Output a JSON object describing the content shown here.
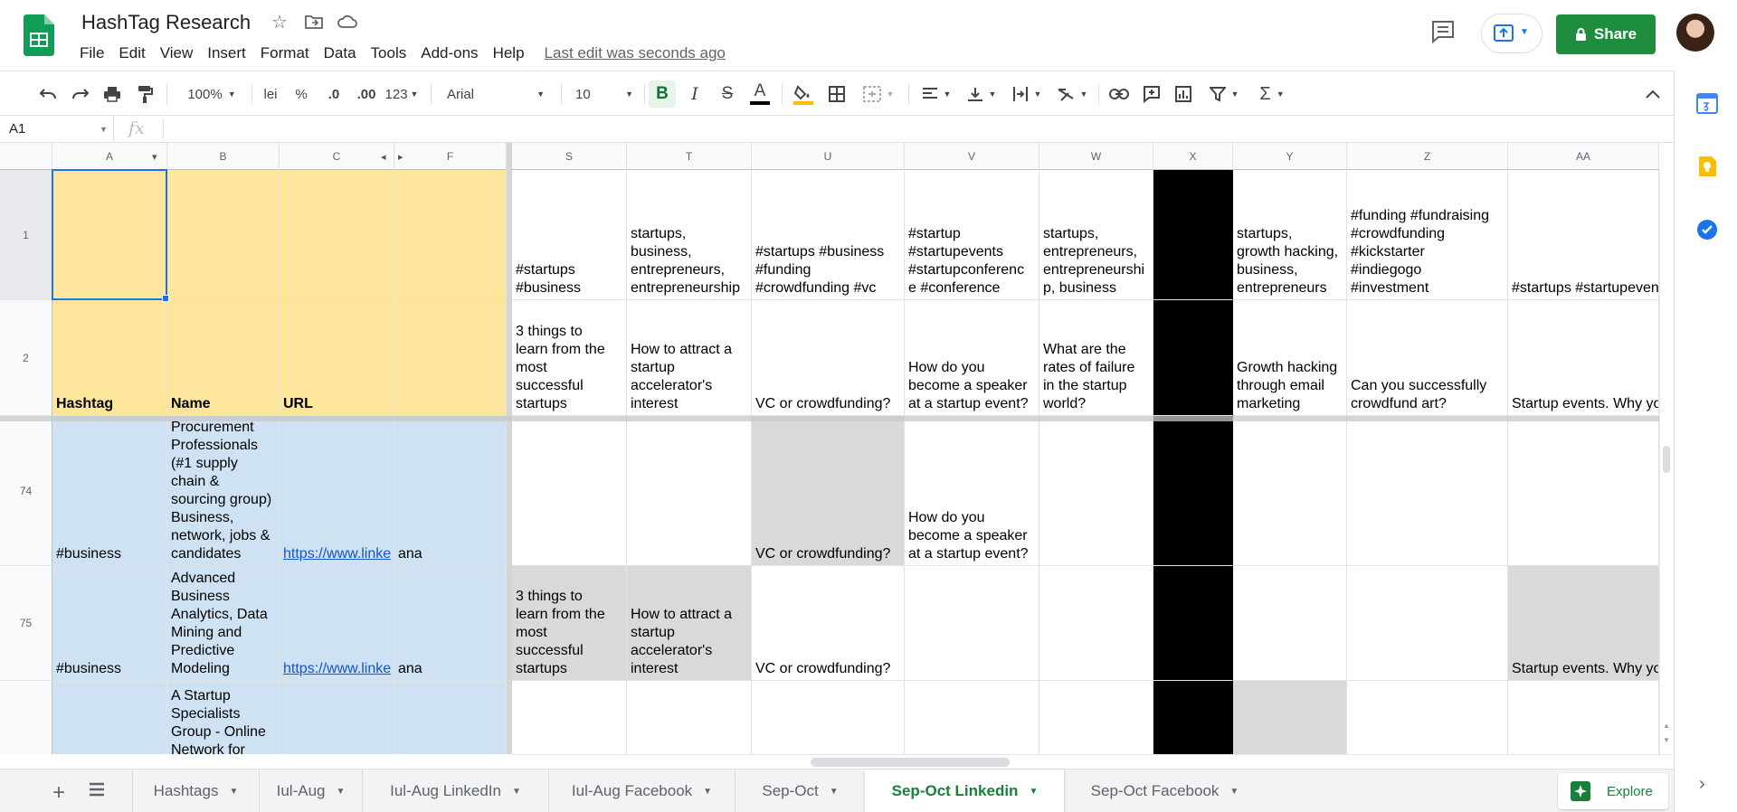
{
  "app": {
    "title": "HashTag Research",
    "menus": [
      "File",
      "Edit",
      "View",
      "Insert",
      "Format",
      "Data",
      "Tools",
      "Add-ons",
      "Help"
    ],
    "last_edit": "Last edit was seconds ago",
    "share_label": "Share"
  },
  "toolbar": {
    "zoom": "100%",
    "currency": "lei",
    "percent": "%",
    "dec_decrease": ".0",
    "dec_increase": ".00",
    "more_formats": "123",
    "font": "Arial",
    "font_size": "10",
    "bold": "B"
  },
  "formula": {
    "cell_ref": "A1",
    "fx": "fx",
    "value": ""
  },
  "grid": {
    "columns": [
      "A",
      "B",
      "C",
      "F",
      "S",
      "T",
      "U",
      "V",
      "W",
      "X",
      "Y",
      "Z",
      "AA"
    ],
    "row_numbers": [
      "1",
      "2",
      "74",
      "75",
      ""
    ],
    "rows": [
      {
        "cells": [
          "",
          "",
          "",
          "",
          "#startups\n#business",
          "startups,\nbusiness,\nentrepreneurs,\nentrepreneurship",
          "#startups #business\n#funding\n#crowdfunding #vc",
          "#startup\n#startupevents\n#startupconferenc\ne #conference",
          "startups,\nentrepreneurs,\nentrepreneurshi\np, business",
          "",
          "startups,\ngrowth hacking,\nbusiness,\nentrepreneurs",
          "#funding #fundraising\n#crowdfunding\n#kickstarter\n#indiegogo\n#investment",
          "#startups #startupeven\n#business #entreprene\n#entrepreneurship"
        ]
      },
      {
        "cells": [
          "Hashtag",
          "Name",
          "URL",
          "",
          "3 things to\nlearn from the\nmost\nsuccessful\nstartups",
          "How to attract a\nstartup\naccelerator's\ninterest",
          "VC or crowdfunding?",
          "How do you\nbecome a speaker\nat a startup event?",
          "What are the\nrates of failure\nin the startup\nworld?",
          "",
          "Growth hacking\nthrough email\nmarketing",
          "Can you successfully\ncrowdfund art?",
          "Startup events. Why yo\nshouldn't skip legal\nissues."
        ]
      },
      {
        "cells": [
          "#business",
          "Procurement\nProfessionals\n(#1 supply\nchain &\nsourcing group)\nBusiness,\nnetwork, jobs &\ncandidates",
          "https://www.linke",
          "ana",
          "",
          "",
          "VC or crowdfunding?",
          "How do you\nbecome a speaker\nat a startup event?",
          "",
          "",
          "",
          "",
          ""
        ]
      },
      {
        "cells": [
          "#business",
          "Advanced\nBusiness\nAnalytics, Data\nMining and\nPredictive\nModeling",
          "https://www.linke",
          "ana",
          "3 things to\nlearn from the\nmost\nsuccessful\nstartups",
          "How to attract a\nstartup\naccelerator's\ninterest",
          "VC or crowdfunding?",
          "",
          "",
          "",
          "",
          "",
          "Startup events. Why yo\nshouldn't skip legal\nissues."
        ]
      },
      {
        "cells": [
          "",
          "A Startup\nSpecialists\nGroup - Online\nNetwork for",
          "",
          "",
          "",
          "",
          "",
          "",
          "",
          "",
          "",
          "",
          ""
        ]
      }
    ]
  },
  "sheets": {
    "tabs": [
      "Hashtags",
      "Iul-Aug",
      "Iul-Aug LinkedIn",
      "Iul-Aug Facebook",
      "Sep-Oct",
      "Sep-Oct Linkedin",
      "Sep-Oct Facebook"
    ],
    "active": "Sep-Oct Linkedin",
    "explore_label": "Explore"
  },
  "colors": {
    "header_fill": "#fde59b",
    "data_fill": "#cfe2f3",
    "highlight_fill": "#d9d9d9",
    "black_column": "#000000",
    "accent_green": "#188038",
    "selection_blue": "#1a73e8"
  }
}
